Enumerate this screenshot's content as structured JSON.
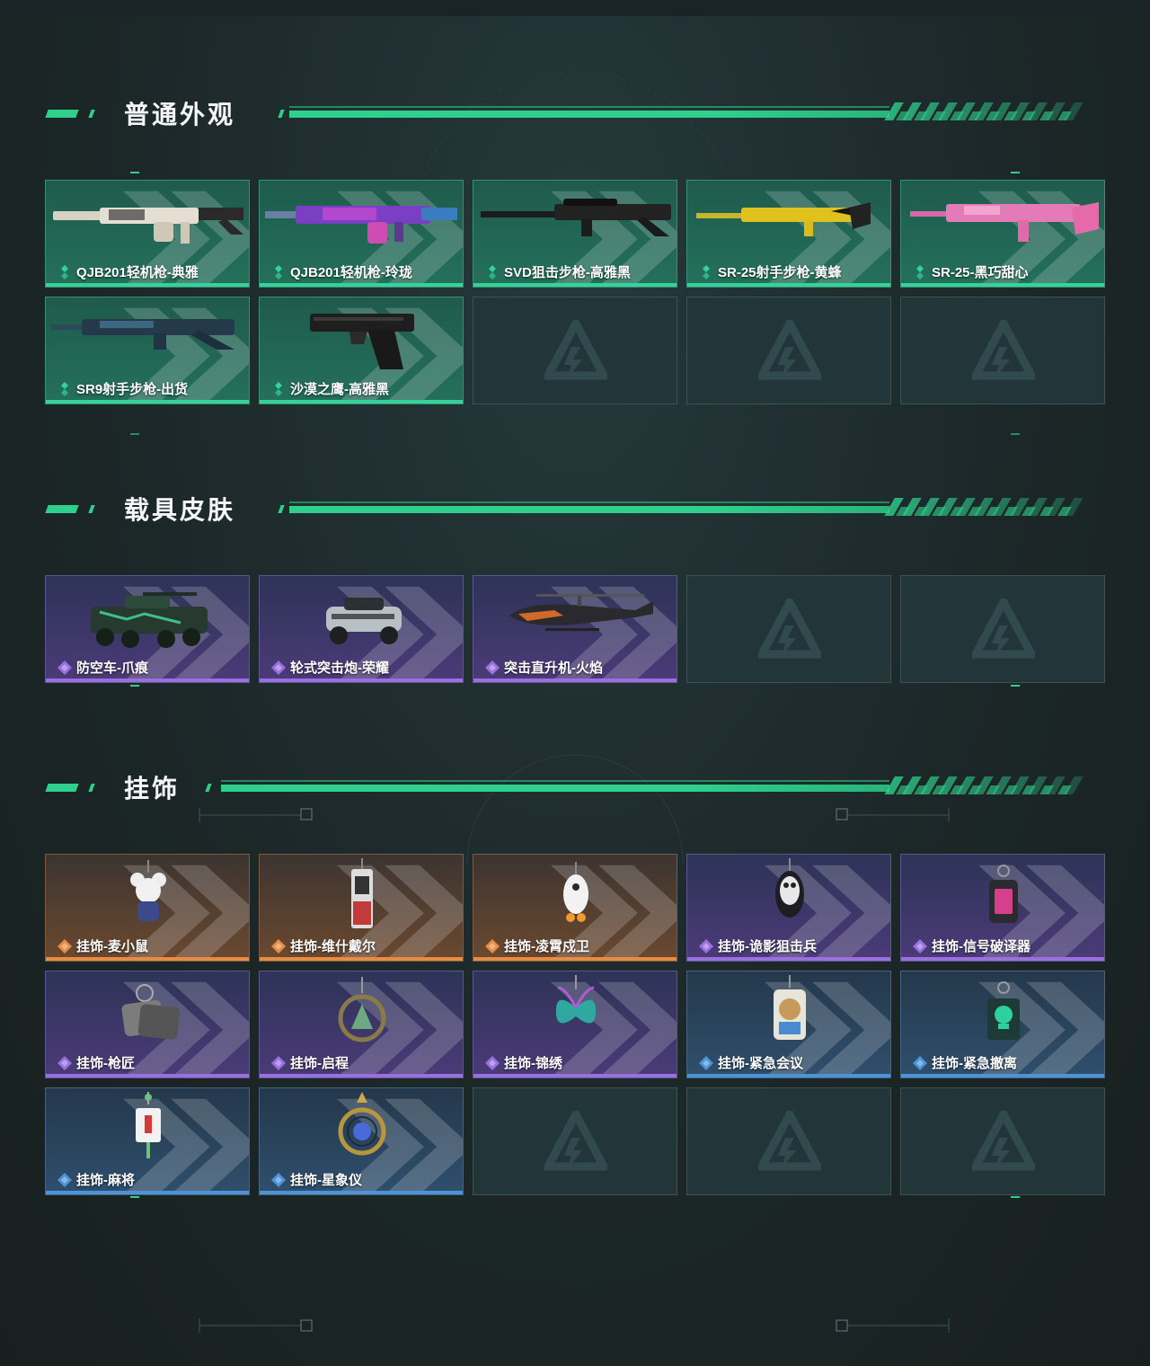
{
  "sections": [
    {
      "title": "普通外观",
      "items": [
        {
          "label": "QJB201轻机枪-典雅",
          "rarity": "green",
          "art": "lmg-white"
        },
        {
          "label": "QJB201轻机枪-玲珑",
          "rarity": "green",
          "art": "lmg-purple"
        },
        {
          "label": "SVD狙击步枪-高雅黑",
          "rarity": "green",
          "art": "sniper-black"
        },
        {
          "label": "SR-25射手步枪-黄蜂",
          "rarity": "green",
          "art": "rifle-yellow"
        },
        {
          "label": "SR-25-黑巧甜心",
          "rarity": "green",
          "art": "rifle-pink"
        },
        {
          "label": "SR9射手步枪-出货",
          "rarity": "green",
          "art": "rifle-teal"
        },
        {
          "label": "沙漠之鹰-高雅黑",
          "rarity": "green",
          "art": "pistol-black"
        },
        {
          "label": "",
          "rarity": "empty"
        },
        {
          "label": "",
          "rarity": "empty"
        },
        {
          "label": "",
          "rarity": "empty"
        }
      ]
    },
    {
      "title": "载具皮肤",
      "items": [
        {
          "label": "防空车-爪痕",
          "rarity": "purple",
          "art": "apc"
        },
        {
          "label": "轮式突击炮-荣耀",
          "rarity": "purple",
          "art": "buggy"
        },
        {
          "label": "突击直升机-火焰",
          "rarity": "purple",
          "art": "heli"
        },
        {
          "label": "",
          "rarity": "empty"
        },
        {
          "label": "",
          "rarity": "empty"
        }
      ]
    },
    {
      "title": "挂饰",
      "items": [
        {
          "label": "挂饰-麦小鼠",
          "rarity": "orange",
          "art": "charm-mouse"
        },
        {
          "label": "挂饰-维什戴尔",
          "rarity": "orange",
          "art": "charm-tag"
        },
        {
          "label": "挂饰-凌霄戍卫",
          "rarity": "orange",
          "art": "charm-duck"
        },
        {
          "label": "挂饰-诡影狙击兵",
          "rarity": "purple",
          "art": "charm-bird"
        },
        {
          "label": "挂饰-信号破译器",
          "rarity": "purple",
          "art": "charm-device"
        },
        {
          "label": "挂饰-枪匠",
          "rarity": "purple",
          "art": "charm-dogtag"
        },
        {
          "label": "挂饰-启程",
          "rarity": "purple",
          "art": "charm-medal"
        },
        {
          "label": "挂饰-锦绣",
          "rarity": "purple",
          "art": "charm-butterfly"
        },
        {
          "label": "挂饰-紧急会议",
          "rarity": "blue",
          "art": "charm-bear"
        },
        {
          "label": "挂饰-紧急撤离",
          "rarity": "blue",
          "art": "charm-skull"
        },
        {
          "label": "挂饰-麻将",
          "rarity": "blue",
          "art": "charm-mahjong"
        },
        {
          "label": "挂饰-星象仪",
          "rarity": "blue",
          "art": "charm-astro"
        },
        {
          "label": "",
          "rarity": "empty"
        },
        {
          "label": "",
          "rarity": "empty"
        },
        {
          "label": "",
          "rarity": "empty"
        }
      ]
    }
  ],
  "colors": {
    "accent": "#2fd08c",
    "green": "#33d39a",
    "purple": "#9a6fe0",
    "orange": "#e88b45",
    "blue": "#4d93d8"
  }
}
